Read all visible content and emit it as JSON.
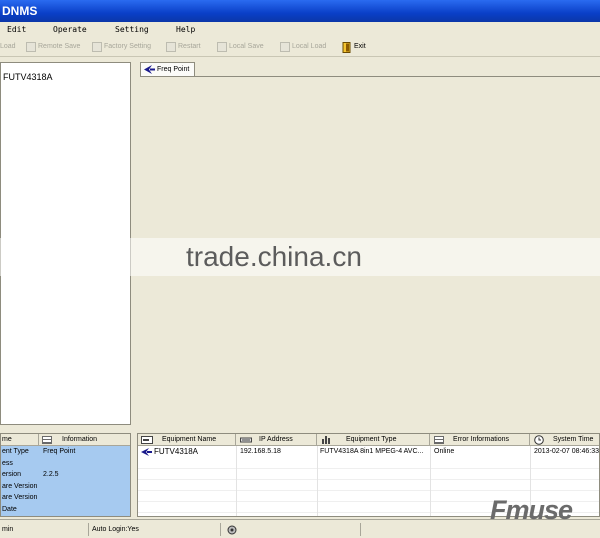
{
  "window": {
    "title": "DNMS"
  },
  "menu": [
    "Edit",
    "Operate",
    "Setting",
    "Help"
  ],
  "toolbar": {
    "load": "Load",
    "remote_save": "Remote Save",
    "factory_setting": "Factory Setting",
    "restart": "Restart",
    "local_save": "Local Save",
    "local_load": "Local Load",
    "exit": "Exit"
  },
  "tree": {
    "node": "FUTV4318A"
  },
  "tabs": {
    "freq_point": "Freq Point"
  },
  "watermark": "trade.china.cn",
  "info_panel": {
    "headers": [
      "me",
      "Information"
    ],
    "rows": [
      {
        "name": "ent Type",
        "value": "Freq Point"
      },
      {
        "name": "ess",
        "value": ""
      },
      {
        "name": "ersion",
        "value": "2.2.5"
      },
      {
        "name": "are Version",
        "value": ""
      },
      {
        "name": "are Version",
        "value": ""
      },
      {
        "name": "Date",
        "value": ""
      }
    ]
  },
  "equipment": {
    "headers": [
      "Equipment Name",
      "IP Address",
      "Equipment Type",
      "Error Informations",
      "System Time"
    ],
    "row": {
      "name": "FUTV4318A",
      "ip": "192.168.5.18",
      "type": "FUTV4318A 8in1 MPEG-4 AVC...",
      "error": "Online",
      "time": "2013-02-07 08:46:33"
    }
  },
  "status": {
    "user": "min",
    "auto_login": "Auto Login:Yes"
  },
  "brand": "Fmuse"
}
